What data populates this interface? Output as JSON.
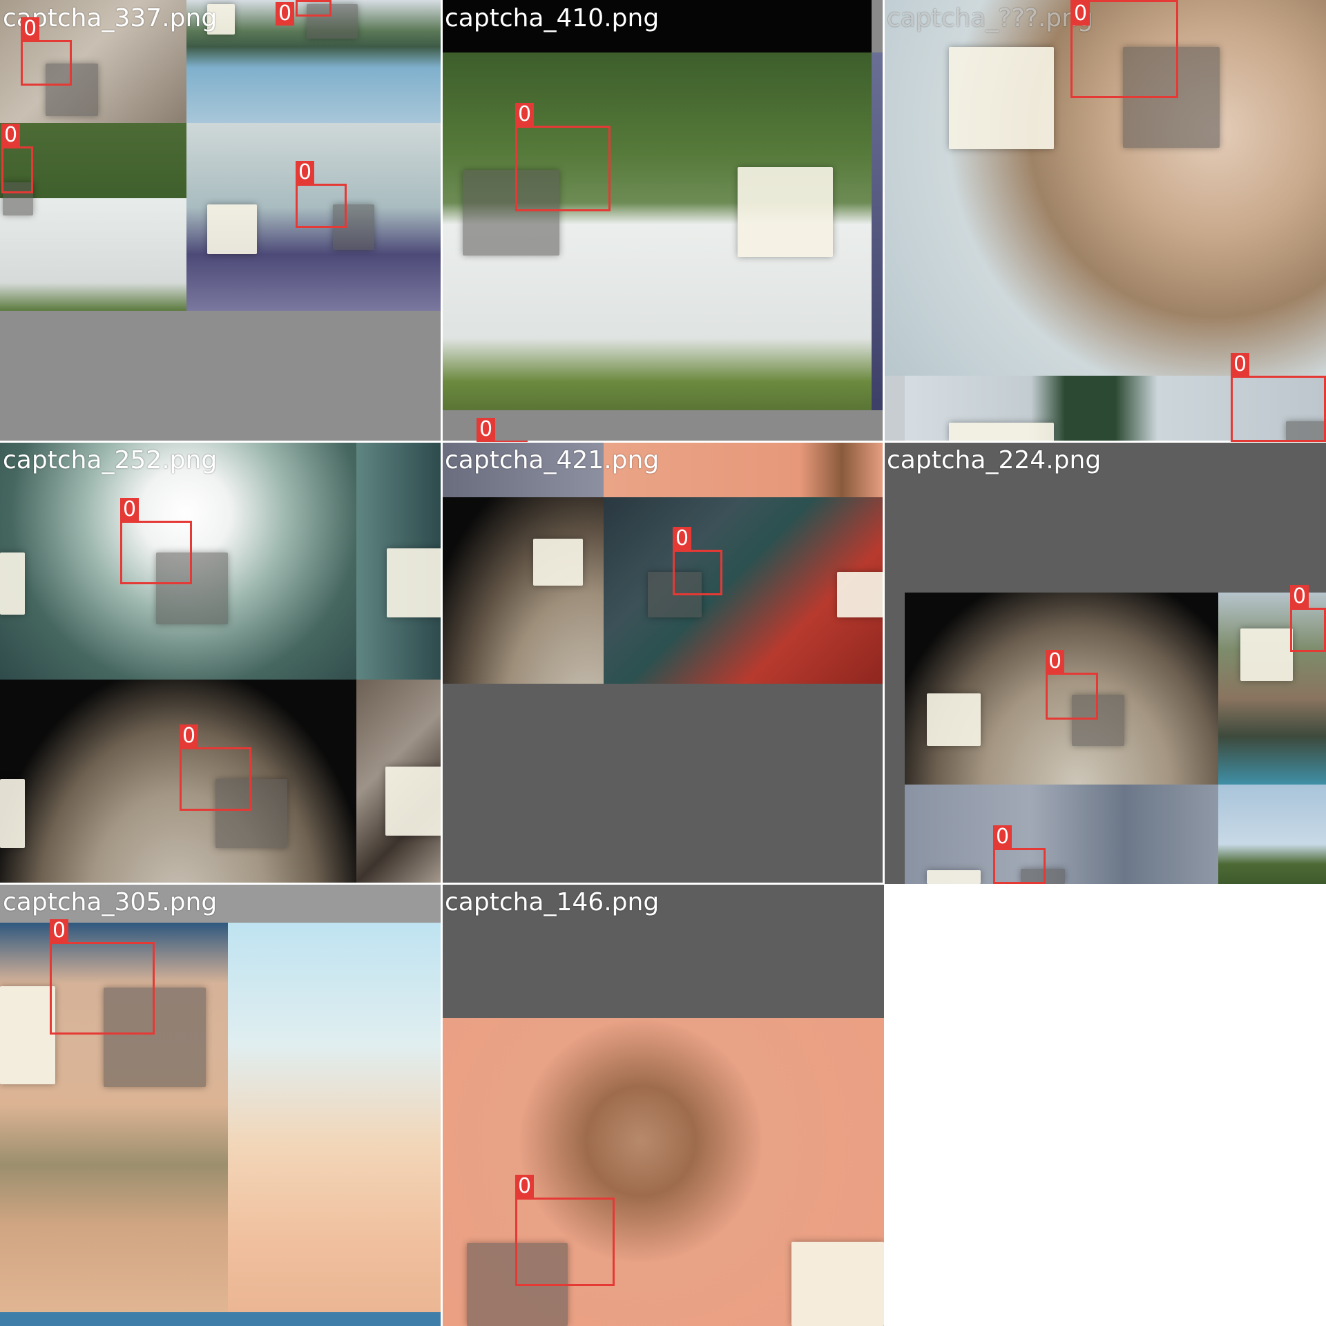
{
  "grid": {
    "tiles": [
      {
        "title": "captcha_337.png"
      },
      {
        "title": "captcha_410.png"
      },
      {
        "title": "captcha_???.png"
      },
      {
        "title": "captcha_252.png"
      },
      {
        "title": "captcha_421.png"
      },
      {
        "title": "captcha_224.png"
      },
      {
        "title": "captcha_305.png"
      },
      {
        "title": "captcha_146.png"
      }
    ]
  },
  "detection": {
    "class_label": "0",
    "box_color": "#e53935"
  },
  "colors": {
    "tile_background_gray": "#9a9a9a",
    "tile_dark_gray": "#5e5e5e",
    "page_background": "#ffffff"
  }
}
